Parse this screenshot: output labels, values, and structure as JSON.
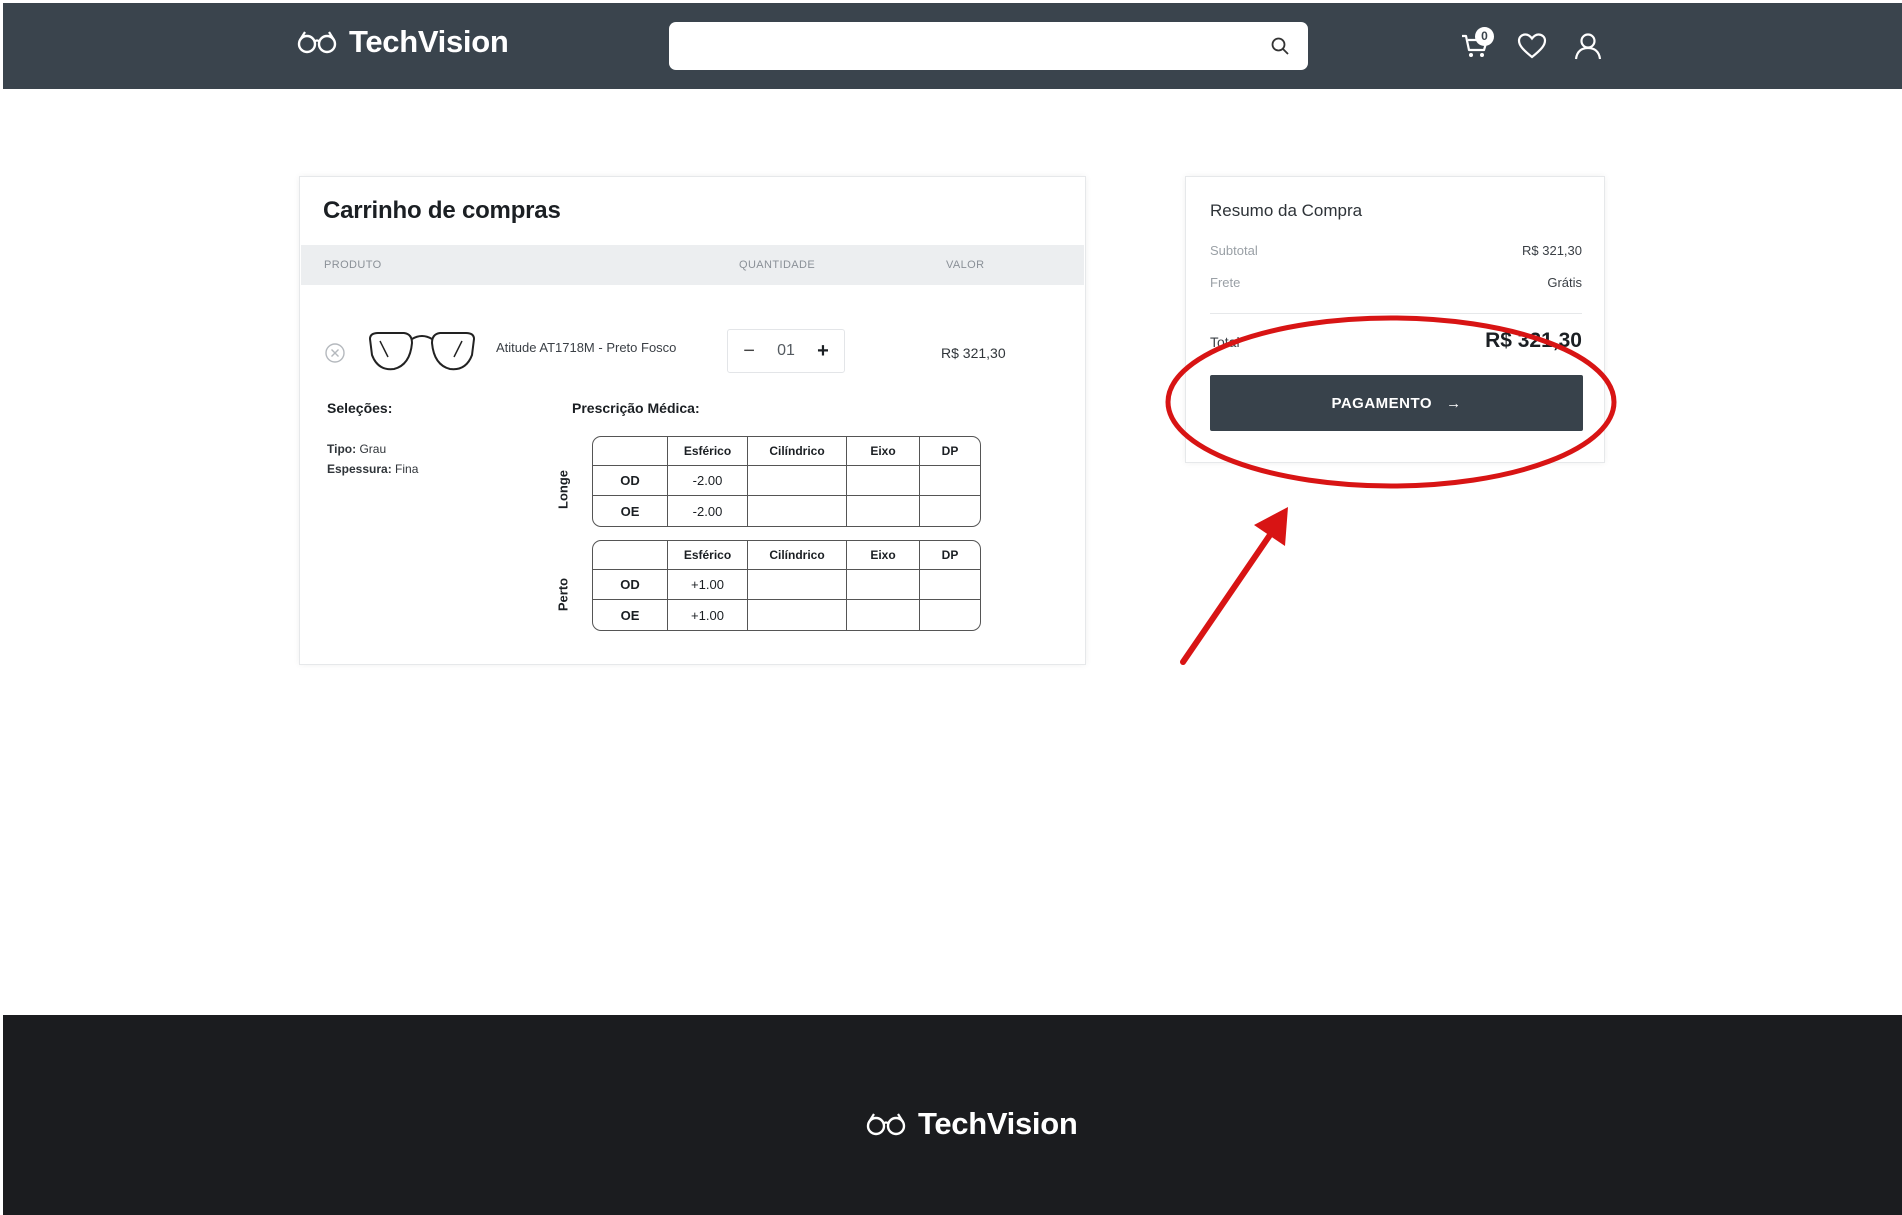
{
  "header": {
    "brand": "TechVision",
    "search": {
      "placeholder": "",
      "value": ""
    },
    "cart_count": "0",
    "icons": [
      "glasses-logo-icon",
      "search-icon",
      "cart-icon",
      "heart-icon",
      "user-icon"
    ]
  },
  "cart": {
    "title": "Carrinho de compras",
    "columns": {
      "product": "PRODUTO",
      "quantity": "QUANTIDADE",
      "value": "VALOR"
    },
    "item": {
      "name": "Atitude AT1718M - Preto Fosco",
      "quantity": "01",
      "qty_minus": "−",
      "qty_plus": "+",
      "price": "R$ 321,30"
    },
    "selections": {
      "title": "Seleções:",
      "type_label": "Tipo:",
      "type_value": "Grau",
      "thickness_label": "Espessura:",
      "thickness_value": "Fina"
    },
    "prescription": {
      "title": "Prescrição Médica:",
      "headers": [
        "Esférico",
        "Cilíndrico",
        "Eixo",
        "DP"
      ],
      "far": {
        "label": "Longe",
        "rows": [
          {
            "eye": "OD",
            "esferico": "-2.00",
            "cilindrico": "",
            "eixo": "",
            "dp": ""
          },
          {
            "eye": "OE",
            "esferico": "-2.00",
            "cilindrico": "",
            "eixo": "",
            "dp": ""
          }
        ]
      },
      "near": {
        "label": "Perto",
        "rows": [
          {
            "eye": "OD",
            "esferico": "+1.00",
            "cilindrico": "",
            "eixo": "",
            "dp": ""
          },
          {
            "eye": "OE",
            "esferico": "+1.00",
            "cilindrico": "",
            "eixo": "",
            "dp": ""
          }
        ]
      }
    }
  },
  "summary": {
    "title": "Resumo da Compra",
    "subtotal_label": "Subtotal",
    "subtotal_value": "R$ 321,30",
    "shipping_label": "Frete",
    "shipping_value": "Grátis",
    "total_label": "Total",
    "total_value": "R$ 321,30",
    "pay_button": "PAGAMENTO",
    "pay_arrow": "→"
  },
  "footer": {
    "brand": "TechVision"
  },
  "colors": {
    "header_bg": "#3a444d",
    "footer_bg": "#1b1c1f",
    "button_bg": "#38424b",
    "annotation_red": "#d81414"
  }
}
